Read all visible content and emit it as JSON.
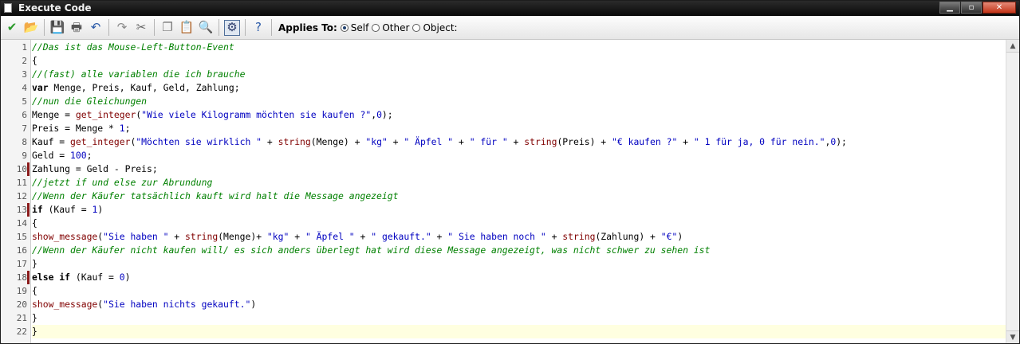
{
  "window": {
    "title": "Execute Code",
    "buttons": {
      "minimize": "▁",
      "maximize": "▫",
      "close": "✕"
    }
  },
  "toolbar": {
    "icons": [
      {
        "name": "accept-icon",
        "glyph": "✔",
        "color": "#2a9a2a"
      },
      {
        "name": "open-icon",
        "glyph": "📂",
        "color": "#c89a2a"
      },
      {
        "name": "save-icon",
        "glyph": "💾",
        "color": "#2a4a9a"
      },
      {
        "name": "print-icon",
        "glyph": "🖶",
        "color": "#555555"
      },
      {
        "name": "undo-icon",
        "glyph": "↶",
        "color": "#2a5aa8"
      },
      {
        "name": "redo-icon",
        "glyph": "↷",
        "color": "#8a8a8a"
      },
      {
        "name": "cut-icon",
        "glyph": "✂",
        "color": "#666666"
      },
      {
        "name": "copy-icon",
        "glyph": "❐",
        "color": "#777777"
      },
      {
        "name": "paste-icon",
        "glyph": "📋",
        "color": "#777777"
      },
      {
        "name": "find-icon",
        "glyph": "🔍",
        "color": "#5a5a5a"
      },
      {
        "name": "syntax-check-icon",
        "glyph": "⚙",
        "color": "#2a3a6a"
      },
      {
        "name": "help-icon",
        "glyph": "?",
        "color": "#2a5aa8"
      }
    ],
    "applies_to_label": "Applies To:",
    "options": [
      {
        "label": "Self",
        "selected": true
      },
      {
        "label": "Other",
        "selected": false
      },
      {
        "label": "Object:",
        "selected": false
      }
    ]
  },
  "editor": {
    "marked_lines": [
      10,
      13,
      18
    ],
    "current_line": 22,
    "lines": [
      {
        "n": "1",
        "tokens": [
          {
            "t": "//Das ist das Mouse-Left-Button-Event",
            "k": "comment"
          }
        ]
      },
      {
        "n": "2",
        "tokens": [
          {
            "t": "{",
            "k": "text"
          }
        ]
      },
      {
        "n": "3",
        "tokens": [
          {
            "t": "//(fast) alle variablen die ich brauche",
            "k": "comment"
          }
        ]
      },
      {
        "n": "4",
        "tokens": [
          {
            "t": "var",
            "k": "keyword"
          },
          {
            "t": " Menge, Preis, Kauf, Geld, Zahlung;",
            "k": "text"
          }
        ]
      },
      {
        "n": "5",
        "tokens": [
          {
            "t": "//nun die Gleichungen",
            "k": "comment"
          }
        ]
      },
      {
        "n": "6",
        "tokens": [
          {
            "t": "Menge = ",
            "k": "text"
          },
          {
            "t": "get_integer",
            "k": "function"
          },
          {
            "t": "(",
            "k": "text"
          },
          {
            "t": "\"Wie viele Kilogramm möchten sie kaufen ?\"",
            "k": "string"
          },
          {
            "t": ",",
            "k": "text"
          },
          {
            "t": "0",
            "k": "number"
          },
          {
            "t": ");",
            "k": "text"
          }
        ]
      },
      {
        "n": "7",
        "tokens": [
          {
            "t": "Preis = Menge * ",
            "k": "text"
          },
          {
            "t": "1",
            "k": "number"
          },
          {
            "t": ";",
            "k": "text"
          }
        ]
      },
      {
        "n": "8",
        "tokens": [
          {
            "t": "Kauf = ",
            "k": "text"
          },
          {
            "t": "get_integer",
            "k": "function"
          },
          {
            "t": "(",
            "k": "text"
          },
          {
            "t": "\"Möchten sie wirklich \"",
            "k": "string"
          },
          {
            "t": " + ",
            "k": "text"
          },
          {
            "t": "string",
            "k": "function"
          },
          {
            "t": "(Menge) + ",
            "k": "text"
          },
          {
            "t": "\"kg\"",
            "k": "string"
          },
          {
            "t": " + ",
            "k": "text"
          },
          {
            "t": "\" Äpfel \"",
            "k": "string"
          },
          {
            "t": " + ",
            "k": "text"
          },
          {
            "t": "\" für \"",
            "k": "string"
          },
          {
            "t": " + ",
            "k": "text"
          },
          {
            "t": "string",
            "k": "function"
          },
          {
            "t": "(Preis) + ",
            "k": "text"
          },
          {
            "t": "\"€ kaufen ?\"",
            "k": "string"
          },
          {
            "t": " + ",
            "k": "text"
          },
          {
            "t": "\" 1 für ja, 0 für nein.\"",
            "k": "string"
          },
          {
            "t": ",",
            "k": "text"
          },
          {
            "t": "0",
            "k": "number"
          },
          {
            "t": ");",
            "k": "text"
          }
        ]
      },
      {
        "n": "9",
        "tokens": [
          {
            "t": "Geld = ",
            "k": "text"
          },
          {
            "t": "100",
            "k": "number"
          },
          {
            "t": ";",
            "k": "text"
          }
        ]
      },
      {
        "n": "10",
        "tokens": [
          {
            "t": "Zahlung = Geld - Preis;",
            "k": "text"
          }
        ]
      },
      {
        "n": "11",
        "tokens": [
          {
            "t": "//jetzt if und else zur Abrundung",
            "k": "comment"
          }
        ]
      },
      {
        "n": "12",
        "tokens": [
          {
            "t": "//Wenn der Käufer tatsächlich kauft wird halt die Message angezeigt",
            "k": "comment"
          }
        ]
      },
      {
        "n": "13",
        "tokens": [
          {
            "t": "if",
            "k": "keyword"
          },
          {
            "t": " (Kauf = ",
            "k": "text"
          },
          {
            "t": "1",
            "k": "number"
          },
          {
            "t": ")",
            "k": "text"
          }
        ]
      },
      {
        "n": "14",
        "tokens": [
          {
            "t": "{",
            "k": "text"
          }
        ]
      },
      {
        "n": "15",
        "tokens": [
          {
            "t": "show_message",
            "k": "function"
          },
          {
            "t": "(",
            "k": "text"
          },
          {
            "t": "\"Sie haben \"",
            "k": "string"
          },
          {
            "t": " + ",
            "k": "text"
          },
          {
            "t": "string",
            "k": "function"
          },
          {
            "t": "(Menge)+ ",
            "k": "text"
          },
          {
            "t": "\"kg\"",
            "k": "string"
          },
          {
            "t": " + ",
            "k": "text"
          },
          {
            "t": "\" Äpfel \"",
            "k": "string"
          },
          {
            "t": " + ",
            "k": "text"
          },
          {
            "t": "\" gekauft.\"",
            "k": "string"
          },
          {
            "t": " + ",
            "k": "text"
          },
          {
            "t": "\" Sie haben noch \"",
            "k": "string"
          },
          {
            "t": " + ",
            "k": "text"
          },
          {
            "t": "string",
            "k": "function"
          },
          {
            "t": "(Zahlung) + ",
            "k": "text"
          },
          {
            "t": "\"€\"",
            "k": "string"
          },
          {
            "t": ")",
            "k": "text"
          }
        ]
      },
      {
        "n": "16",
        "tokens": [
          {
            "t": "//Wenn der Käufer nicht kaufen will/ es sich anders überlegt hat wird diese Message angezeigt, was nicht schwer zu sehen ist",
            "k": "comment"
          }
        ]
      },
      {
        "n": "17",
        "tokens": [
          {
            "t": "}",
            "k": "text"
          }
        ]
      },
      {
        "n": "18",
        "tokens": [
          {
            "t": "else",
            "k": "keyword"
          },
          {
            "t": " ",
            "k": "text"
          },
          {
            "t": "if",
            "k": "keyword"
          },
          {
            "t": " (Kauf = ",
            "k": "text"
          },
          {
            "t": "0",
            "k": "number"
          },
          {
            "t": ")",
            "k": "text"
          }
        ]
      },
      {
        "n": "19",
        "tokens": [
          {
            "t": "{",
            "k": "text"
          }
        ]
      },
      {
        "n": "20",
        "tokens": [
          {
            "t": "show_message",
            "k": "function"
          },
          {
            "t": "(",
            "k": "text"
          },
          {
            "t": "\"Sie haben nichts gekauft.\"",
            "k": "string"
          },
          {
            "t": ")",
            "k": "text"
          }
        ]
      },
      {
        "n": "21",
        "tokens": [
          {
            "t": "}",
            "k": "text"
          }
        ]
      },
      {
        "n": "22",
        "tokens": [
          {
            "t": "}",
            "k": "text"
          }
        ]
      }
    ]
  }
}
